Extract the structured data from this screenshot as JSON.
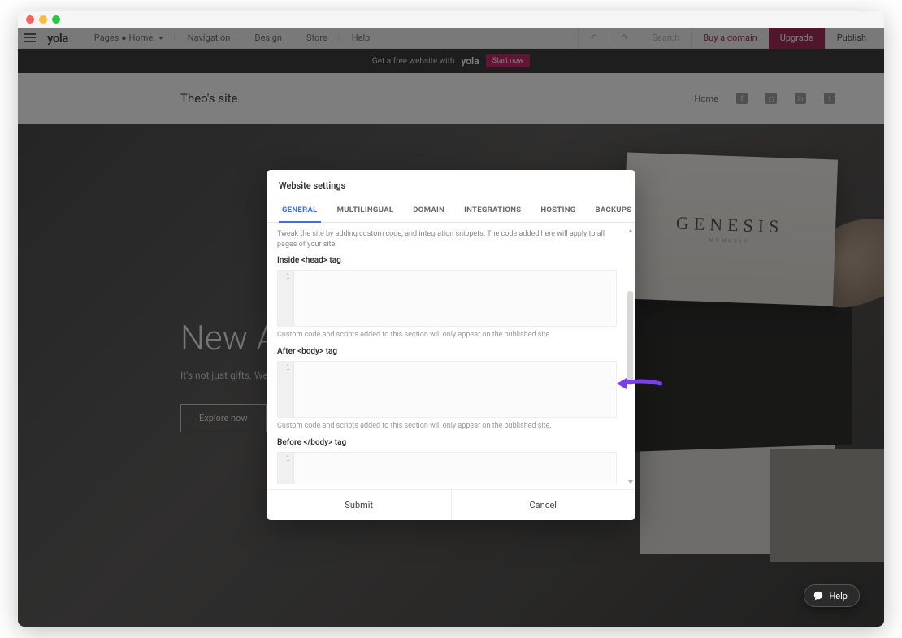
{
  "topbar": {
    "brand": "yola",
    "pages_label": "Pages",
    "pages_current": "Home",
    "nav": {
      "navigation": "Navigation",
      "design": "Design",
      "store": "Store",
      "help": "Help"
    },
    "right": {
      "search": "Search",
      "buy_domain": "Buy a domain",
      "upgrade": "Upgrade",
      "publish": "Publish"
    }
  },
  "promo": {
    "text": "Get a free website with",
    "logo": "yola",
    "cta": "Start now"
  },
  "site": {
    "title": "Theo's site",
    "nav_home": "Home",
    "hero_heading": "New Arrivals",
    "hero_sub": "It's not just gifts. We create emotions.",
    "hero_cta": "Explore now",
    "book_title": "GENESIS",
    "book_sub": "MCMLXIV"
  },
  "modal": {
    "title": "Website settings",
    "tabs": {
      "general": "GENERAL",
      "multilingual": "MULTILINGUAL",
      "domain": "DOMAIN",
      "integrations": "INTEGRATIONS",
      "hosting": "HOSTING",
      "backups": "BACKUPS"
    },
    "intro_hint": "Tweak the site by adding custom code, and integration snippets. The code added here will apply to all pages of your site.",
    "fields": {
      "head": {
        "label": "Inside <head> tag",
        "hint": "Custom code and scripts added to this section will only appear on the published site."
      },
      "after_body": {
        "label": "After <body> tag",
        "hint": "Custom code and scripts added to this section will only appear on the published site."
      },
      "before_body": {
        "label": "Before </body> tag"
      }
    },
    "line_no": "1",
    "submit": "Submit",
    "cancel": "Cancel"
  },
  "help": {
    "label": "Help"
  }
}
